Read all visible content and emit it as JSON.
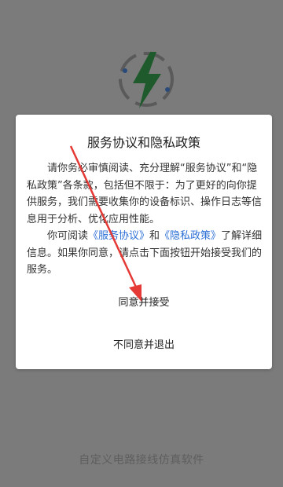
{
  "splash": {
    "footer_text": "自定义电路接线仿真软件"
  },
  "dialog": {
    "title": "服务协议和隐私政策",
    "paragraph1": "请你务必审慎阅读、充分理解“服务协议”和“隐私政策”各条款，包括但不限于：为了更好的向你提供服务，我们需要收集你的设备标识、操作日志等信息用于分析、优化应用性能。",
    "paragraph2_prefix": "你可阅读",
    "link_service": "《服务协议》",
    "and_text": "和",
    "link_privacy": "《隐私政策》",
    "paragraph2_suffix": "了解详细信息。如果你同意，请点击下面按钮开始接受我们的服务。",
    "agree_label": "同意并接受",
    "disagree_label": "不同意并退出"
  },
  "colors": {
    "link": "#2c6fd6",
    "logo_green": "#1f8a3c",
    "arrow_red": "#e53935"
  },
  "icons": {
    "logo": "lightning-bolt-logo",
    "annotation": "red-arrow"
  }
}
